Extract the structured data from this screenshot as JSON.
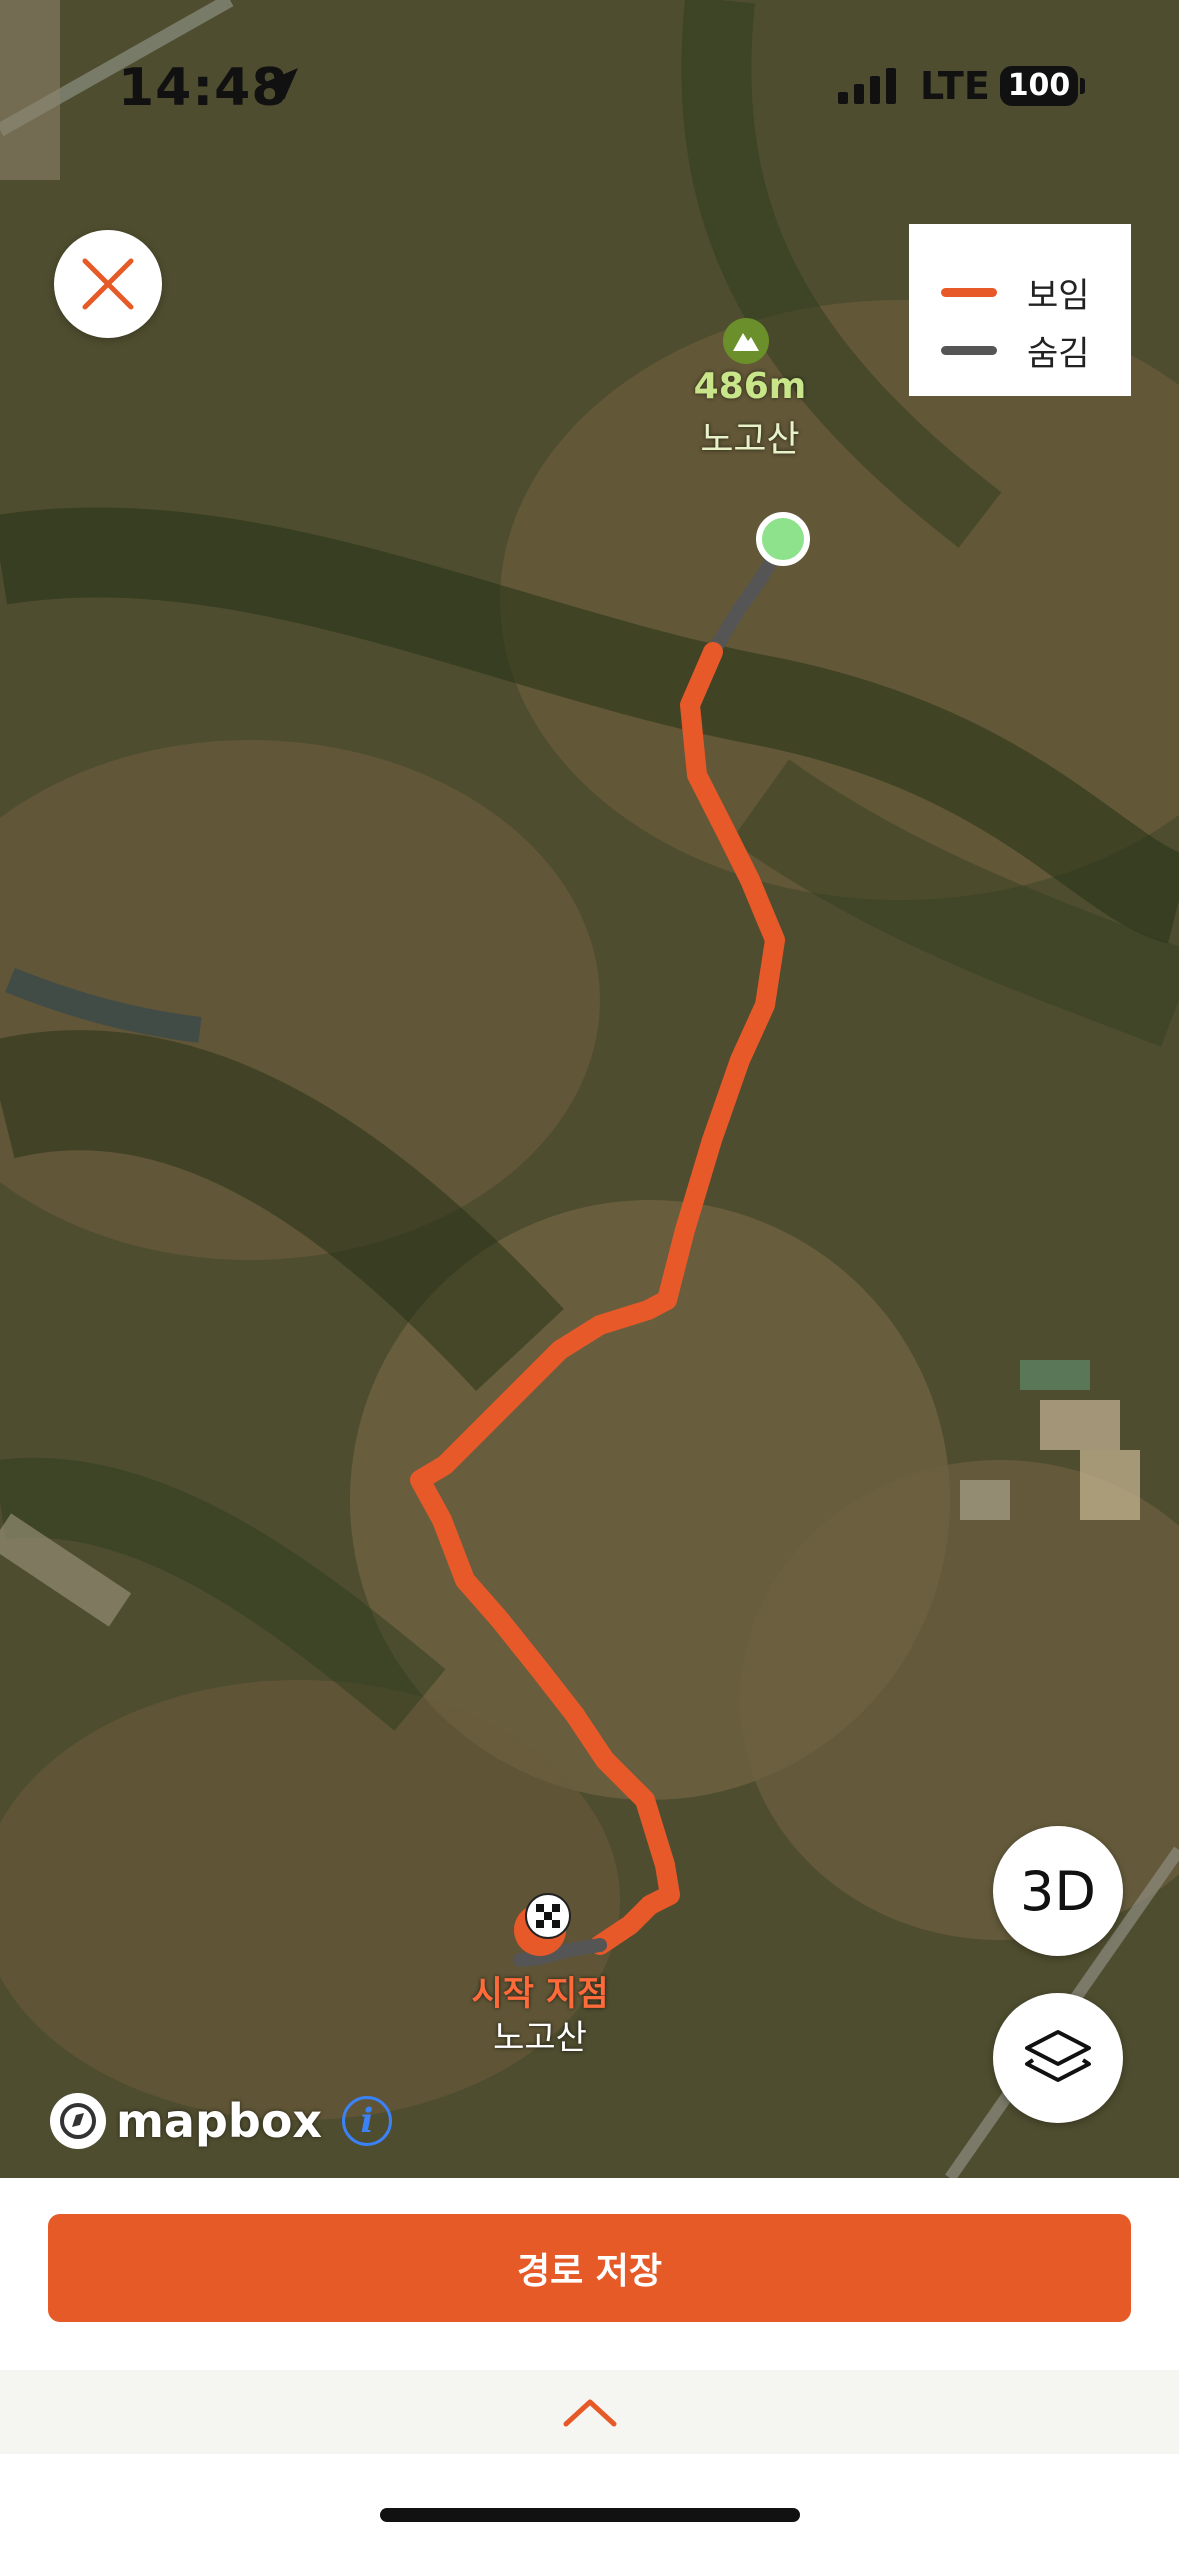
{
  "status_bar": {
    "time": "14:48",
    "network": "LTE",
    "battery": "100"
  },
  "legend": {
    "items": [
      {
        "label": "보임",
        "color": "#e8592a"
      },
      {
        "label": "숨김",
        "color": "#555555"
      }
    ]
  },
  "map": {
    "peak": {
      "altitude": "486m",
      "name": "노고산"
    },
    "start": {
      "label": "시작 지점",
      "sublabel": "노고산"
    },
    "buttons": {
      "three_d": "3D"
    },
    "attribution": "mapbox"
  },
  "actions": {
    "save_route": "경로 저장"
  },
  "colors": {
    "accent": "#e65a28",
    "route_visible": "#e8592a",
    "route_hidden": "#555555",
    "end_marker": "#8ee28c"
  },
  "icons": [
    "close-icon",
    "location-arrow-icon",
    "signal-icon",
    "battery-icon",
    "mountain-icon",
    "checkered-flag-icon",
    "layers-icon",
    "mapbox-icon",
    "info-icon",
    "chevron-up-icon"
  ]
}
